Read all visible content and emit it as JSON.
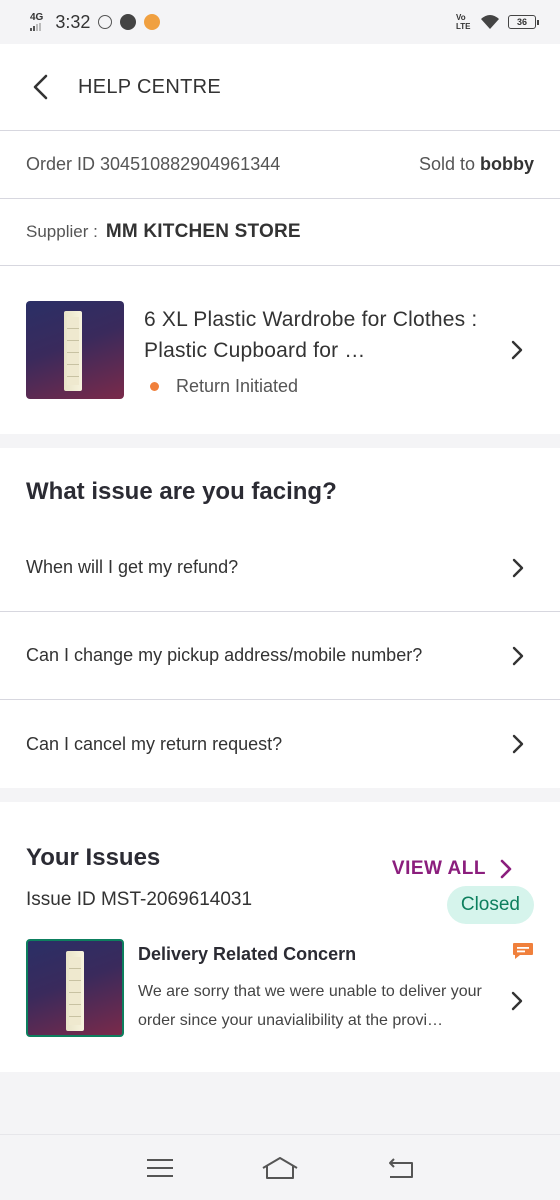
{
  "status_bar": {
    "network": "4G",
    "time": "3:32",
    "volte": "Vo LTE",
    "battery": "36"
  },
  "header": {
    "title": "HELP CENTRE"
  },
  "order": {
    "label": "Order ID",
    "id": "304510882904961344",
    "sold_label": "Sold to",
    "sold_to": "bobby"
  },
  "supplier": {
    "label": "Supplier :",
    "name": "MM KITCHEN STORE"
  },
  "product": {
    "name": "6 XL Plastic Wardrobe for Clothes : Plastic Cupboard for …",
    "status": "Return Initiated"
  },
  "issues": {
    "title": "What issue are you facing?",
    "items": [
      {
        "label": "When will I get my refund?"
      },
      {
        "label": "Can I change my pickup address/mobile number?"
      },
      {
        "label": "Can I cancel my return request?"
      }
    ]
  },
  "your_issues": {
    "title": "Your Issues",
    "view_all": "VIEW ALL",
    "issue_id": "Issue ID MST-2069614031",
    "status": "Closed",
    "card": {
      "heading": "Delivery Related Concern",
      "description": "We are sorry that we were unable to deliver your order since your unavialibility at the provi…"
    }
  },
  "colors": {
    "accent": "#8b1e7d",
    "status_dot": "#f0803c",
    "closed_bg": "#d6f4ec",
    "closed_text": "#0d7f5e",
    "chat_icon": "#f0803c"
  },
  "icons": [
    "back-icon",
    "chevron-right-icon",
    "chat-icon",
    "menu-icon",
    "home-icon",
    "back-nav-icon"
  ]
}
